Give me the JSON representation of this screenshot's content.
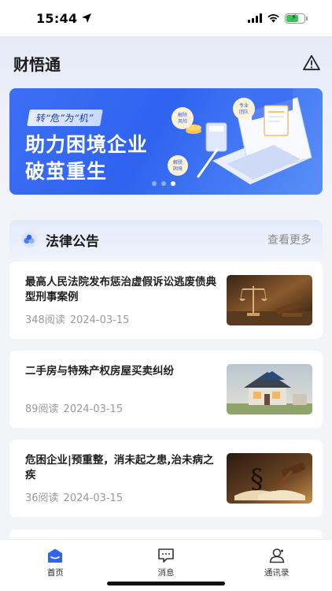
{
  "status_bar": {
    "time": "15:44"
  },
  "header": {
    "title": "财悟通"
  },
  "banner": {
    "tag": "转“危”为“机”",
    "title_line1": "助力困境企业",
    "title_line2": "破茧重生",
    "badges": [
      "专业团队",
      "解除风险",
      "解脱困境"
    ],
    "active_dot": 3
  },
  "section": {
    "title": "法律公告",
    "more_label": "查看更多"
  },
  "news": [
    {
      "title": "最高人民法院发布惩治虚假诉讼逃废债典型刑事案例",
      "reads": "348阅读",
      "date": "2024-03-15"
    },
    {
      "title": "二手房与特殊产权房屋买卖纠纷",
      "reads": "89阅读",
      "date": "2024-03-15"
    },
    {
      "title": "危困企业|预重整，消未起之患,治未病之疾",
      "reads": "36阅读",
      "date": "2024-03-15"
    }
  ],
  "tabbar": {
    "items": [
      {
        "label": "首页"
      },
      {
        "label": "消息"
      },
      {
        "label": "通讯录"
      }
    ]
  },
  "colors": {
    "accent": "#2f63f0",
    "muted": "#9a9a9a"
  }
}
